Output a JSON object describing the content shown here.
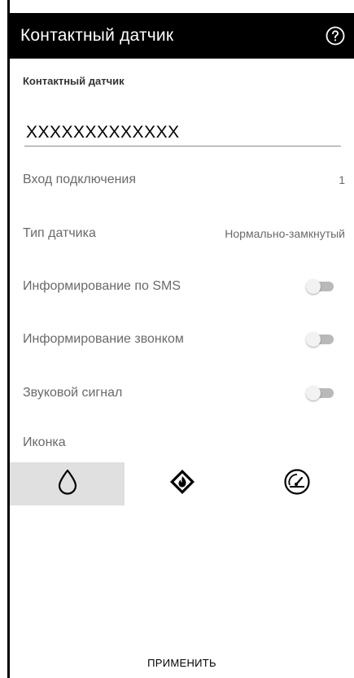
{
  "header": {
    "title": "Контактный датчик",
    "help_icon": "help-circle-icon"
  },
  "form": {
    "section_label": "Контактный датчик",
    "name_value": "XXXXXXXXXXXXX",
    "rows": [
      {
        "label": "Вход подключения",
        "value": "1"
      },
      {
        "label": "Тип датчика",
        "value": "Нормально-замкнутый"
      }
    ],
    "toggles": [
      {
        "label": "Информирование по SMS",
        "on": false
      },
      {
        "label": "Информирование звонком",
        "on": false
      },
      {
        "label": "Звуковой сигнал",
        "on": false
      }
    ],
    "icon_label": "Иконка",
    "icons": [
      {
        "name": "water-drop-icon",
        "selected": true
      },
      {
        "name": "fire-hazard-icon",
        "selected": false
      },
      {
        "name": "gauge-icon",
        "selected": false
      }
    ]
  },
  "apply_label": "ПРИМЕНИТЬ"
}
